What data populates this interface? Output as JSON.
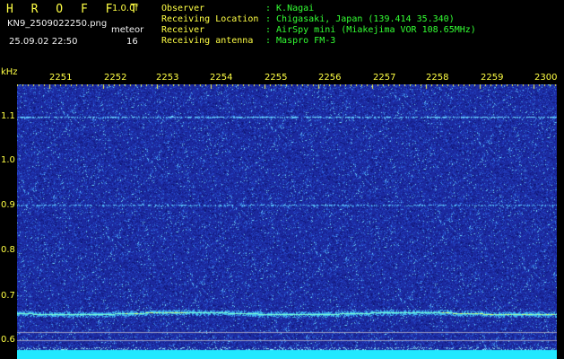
{
  "header": {
    "app_title": "H R O F F T",
    "version": "1.0.0f",
    "filename": "KN9_2509022250.png",
    "datetime": "25.09.02 22:50",
    "meteor_label": "meteor",
    "meteor_count": "16",
    "info": [
      {
        "label": "Observer",
        "value": ": K.Nagai"
      },
      {
        "label": "Receiving Location",
        "value": ": Chigasaki, Japan (139.414 35.340)"
      },
      {
        "label": "Receiver",
        "value": ": AirSpy mini (Miakejima VOR 108.65MHz)"
      },
      {
        "label": "Receiving antenna",
        "value": ": Maspro FM-3"
      }
    ]
  },
  "colors": {
    "header_label": "#ffff44",
    "header_value": "#33ff33",
    "waterfall_background": "#1a2aa8",
    "signal": "#33e0ff"
  },
  "plot": {
    "y_unit": "kHz",
    "x_ticks": [
      "2251",
      "2252",
      "2253",
      "2254",
      "2255",
      "2256",
      "2257",
      "2258",
      "2259",
      "2300"
    ],
    "y_ticks": [
      "1.1",
      "1.0",
      "0.9",
      "0.8",
      "0.7",
      "0.6"
    ]
  }
}
